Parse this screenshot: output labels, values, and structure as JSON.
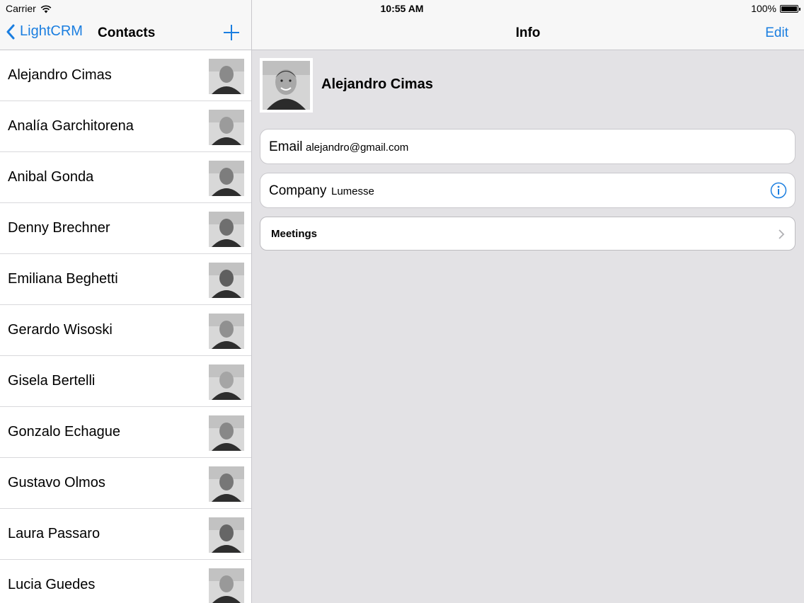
{
  "status": {
    "carrier": "Carrier",
    "time": "10:55 AM",
    "battery": "100%",
    "battery_level": 1.0
  },
  "master": {
    "back_label": "LightCRM",
    "title": "Contacts",
    "contacts": [
      {
        "name": "Alejandro Cimas"
      },
      {
        "name": "Analía Garchitorena"
      },
      {
        "name": "Anibal Gonda"
      },
      {
        "name": "Denny Brechner"
      },
      {
        "name": "Emiliana Beghetti"
      },
      {
        "name": "Gerardo Wisoski"
      },
      {
        "name": "Gisela Bertelli"
      },
      {
        "name": "Gonzalo Echague"
      },
      {
        "name": "Gustavo Olmos"
      },
      {
        "name": "Laura Passaro"
      },
      {
        "name": "Lucia Guedes"
      }
    ]
  },
  "detail": {
    "title": "Info",
    "edit_label": "Edit",
    "contact_name": "Alejandro Cimas",
    "email_label": "Email",
    "email_value": "alejandro@gmail.com",
    "company_label": "Company",
    "company_value": "Lumesse",
    "meetings_label": "Meetings"
  },
  "colors": {
    "accent": "#1a7ee0",
    "detail_bg": "#e3e2e5",
    "nav_bg": "#f7f7f7"
  }
}
